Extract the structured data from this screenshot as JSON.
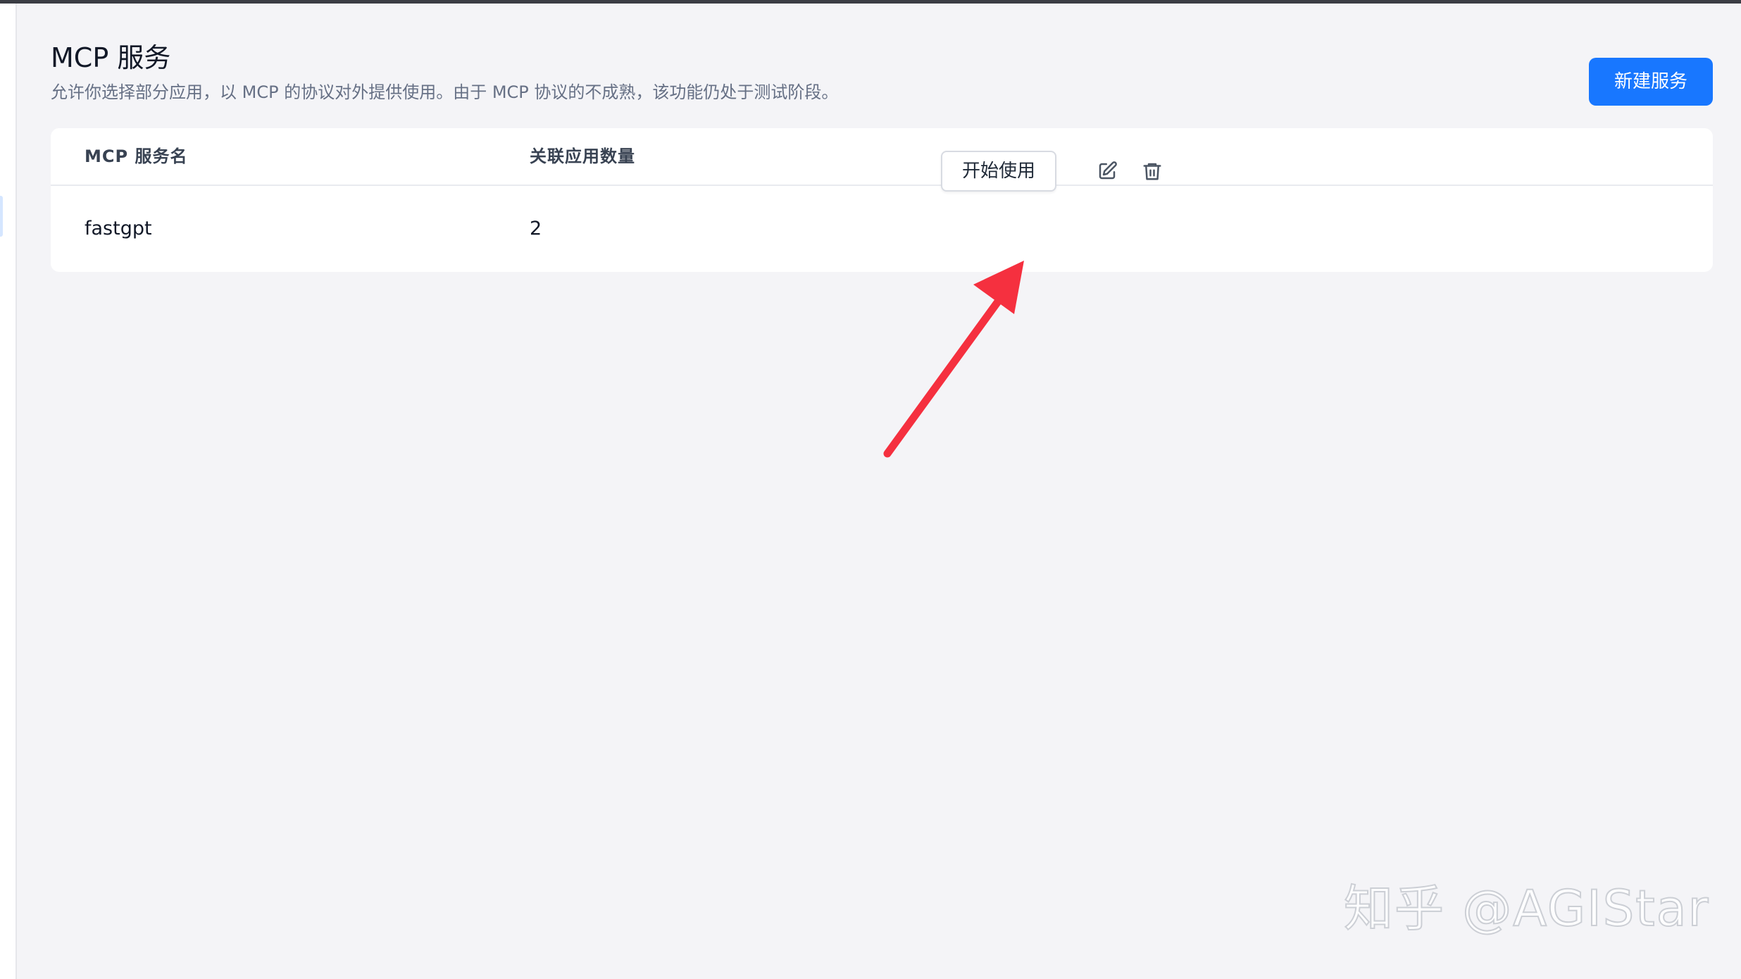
{
  "header": {
    "title": "MCP 服务",
    "description": "允许你选择部分应用，以 MCP 的协议对外提供使用。由于 MCP 协议的不成熟，该功能仍处于测试阶段。",
    "new_button_label": "新建服务"
  },
  "table": {
    "columns": [
      "MCP 服务名",
      "关联应用数量"
    ],
    "rows": [
      {
        "name": "fastgpt",
        "app_count": "2",
        "start_button_label": "开始使用"
      }
    ]
  },
  "icons": {
    "edit": "edit-icon",
    "delete": "trash-icon"
  },
  "colors": {
    "primary": "#1877ff",
    "annotation_arrow": "#f5303f"
  },
  "watermark": "知乎 @AGIStar"
}
